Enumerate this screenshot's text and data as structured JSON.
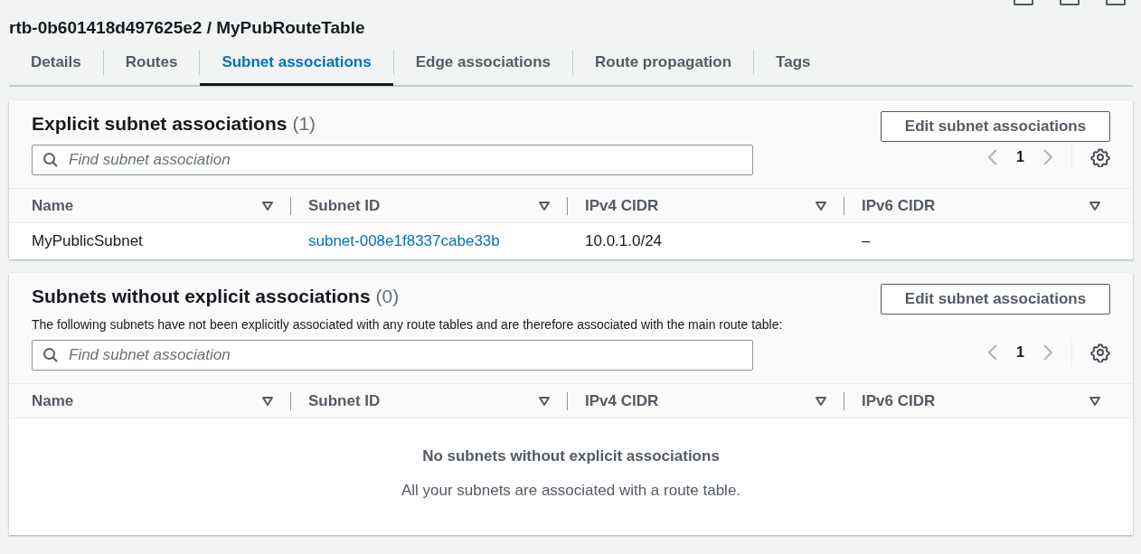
{
  "header": {
    "title": "rtb-0b601418d497625e2 / MyPubRouteTable"
  },
  "tabs": [
    {
      "label": "Details",
      "selected": false
    },
    {
      "label": "Routes",
      "selected": false
    },
    {
      "label": "Subnet associations",
      "selected": true
    },
    {
      "label": "Edge associations",
      "selected": false
    },
    {
      "label": "Route propagation",
      "selected": false
    },
    {
      "label": "Tags",
      "selected": false
    }
  ],
  "sections": [
    {
      "title": "Explicit subnet associations",
      "count": "(1)",
      "button": "Edit subnet associations",
      "search": {
        "placeholder": "Find subnet association"
      },
      "pagination": {
        "page": "1",
        "prev_disabled": true,
        "next_disabled": true
      },
      "columns": [
        "Name",
        "Subnet ID",
        "IPv4 CIDR",
        "IPv6 CIDR"
      ],
      "rows": [
        [
          {
            "text": "MyPublicSubnet",
            "kind": "text"
          },
          {
            "text": "subnet-008e1f8337cabe33b",
            "kind": "link"
          },
          {
            "text": "10.0.1.0/24",
            "kind": "text"
          },
          {
            "text": "–",
            "kind": "text"
          }
        ]
      ]
    },
    {
      "title": "Subnets without explicit associations",
      "count": "(0)",
      "button": "Edit subnet associations",
      "description": "The following subnets have not been explicitly associated with any route tables and are therefore associated with the main route table:",
      "search": {
        "placeholder": "Find subnet association"
      },
      "pagination": {
        "page": "1",
        "prev_disabled": true,
        "next_disabled": true
      },
      "columns": [
        "Name",
        "Subnet ID",
        "IPv4 CIDR",
        "IPv6 CIDR"
      ],
      "empty": {
        "title": "No subnets without explicit associations",
        "message": "All your subnets are associated with a route table."
      }
    }
  ]
}
